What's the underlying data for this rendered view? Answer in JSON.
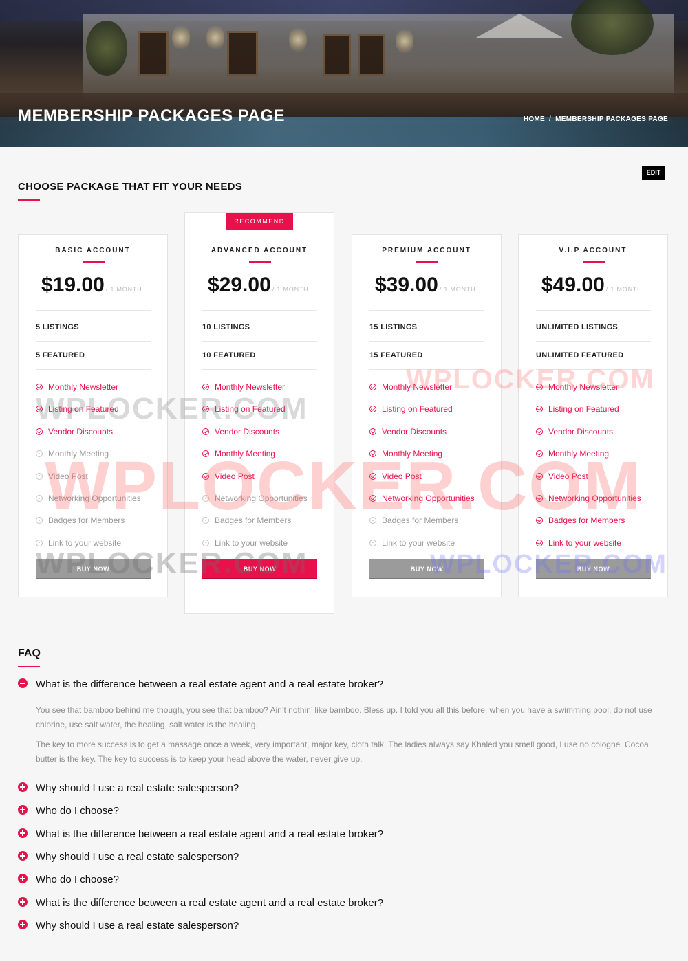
{
  "hero": {
    "title": "MEMBERSHIP PACKAGES PAGE",
    "breadcrumb": [
      "HOME",
      "MEMBERSHIP PACKAGES PAGE"
    ],
    "breadcrumb_sep": "/"
  },
  "edit_label": "EDIT",
  "section_title": "CHOOSE PACKAGE THAT FIT YOUR NEEDS",
  "accent_color": "#e8114b",
  "packages": [
    {
      "name": "BASIC ACCOUNT",
      "price": "$19.00",
      "period": "/ 1 MONTH",
      "listings": "5 LISTINGS",
      "featured": "5 FEATURED",
      "features": [
        {
          "label": "Monthly Newsletter",
          "included": true
        },
        {
          "label": "Listing on Featured",
          "included": true
        },
        {
          "label": "Vendor Discounts",
          "included": true
        },
        {
          "label": "Monthly Meeting",
          "included": false
        },
        {
          "label": "Video Post",
          "included": false
        },
        {
          "label": "Networking Opportunities",
          "included": false
        },
        {
          "label": "Badges for Members",
          "included": false
        },
        {
          "label": "Link to your website",
          "included": false
        }
      ],
      "buy_label": "BUY NOW",
      "recommended": false
    },
    {
      "name": "ADVANCED ACCOUNT",
      "price": "$29.00",
      "period": "/ 1 MONTH",
      "listings": "10 LISTINGS",
      "featured": "10 FEATURED",
      "badge": "RECOMMEND",
      "features": [
        {
          "label": "Monthly Newsletter",
          "included": true
        },
        {
          "label": "Listing on Featured",
          "included": true
        },
        {
          "label": "Vendor Discounts",
          "included": true
        },
        {
          "label": "Monthly Meeting",
          "included": true
        },
        {
          "label": "Video Post",
          "included": true
        },
        {
          "label": "Networking Opportunities",
          "included": false
        },
        {
          "label": "Badges for Members",
          "included": false
        },
        {
          "label": "Link to your website",
          "included": false
        }
      ],
      "buy_label": "BUY NOW",
      "recommended": true
    },
    {
      "name": "PREMIUM ACCOUNT",
      "price": "$39.00",
      "period": "/ 1 MONTH",
      "listings": "15 LISTINGS",
      "featured": "15 FEATURED",
      "features": [
        {
          "label": "Monthly Newsletter",
          "included": true
        },
        {
          "label": "Listing on Featured",
          "included": true
        },
        {
          "label": "Vendor Discounts",
          "included": true
        },
        {
          "label": "Monthly Meeting",
          "included": true
        },
        {
          "label": "Video Post",
          "included": true
        },
        {
          "label": "Networking Opportunities",
          "included": true
        },
        {
          "label": "Badges for Members",
          "included": false
        },
        {
          "label": "Link to your website",
          "included": false
        }
      ],
      "buy_label": "BUY NOW",
      "recommended": false
    },
    {
      "name": "V.I.P ACCOUNT",
      "price": "$49.00",
      "period": "/ 1 MONTH",
      "listings": "UNLIMITED LISTINGS",
      "featured": "UNLIMITED FEATURED",
      "features": [
        {
          "label": "Monthly Newsletter",
          "included": true
        },
        {
          "label": "Listing on Featured",
          "included": true
        },
        {
          "label": "Vendor Discounts",
          "included": true
        },
        {
          "label": "Monthly Meeting",
          "included": true
        },
        {
          "label": "Video Post",
          "included": true
        },
        {
          "label": "Networking Opportunities",
          "included": true
        },
        {
          "label": "Badges for Members",
          "included": true
        },
        {
          "label": "Link to your website",
          "included": true
        }
      ],
      "buy_label": "BUY NOW",
      "recommended": false
    }
  ],
  "faq": {
    "title": "FAQ",
    "items": [
      {
        "question": "What is the difference between a real estate agent and a real estate broker?",
        "expanded": true,
        "answer": [
          "You see that bamboo behind me though, you see that bamboo? Ain’t nothin’ like bamboo. Bless up. I told you all this before, when you have a swimming pool, do not use chlorine, use salt water, the healing, salt water is the healing.",
          "The key to more success is to get a massage once a week, very important, major key, cloth talk. The ladies always say Khaled you smell good, I use no cologne. Cocoa butter is the key. The key to success is to keep your head above the water, never give up."
        ]
      },
      {
        "question": "Why should I use a real estate salesperson?",
        "expanded": false
      },
      {
        "question": "Who do I choose?",
        "expanded": false
      },
      {
        "question": "What is the difference between a real estate agent and a real estate broker?",
        "expanded": false
      },
      {
        "question": "Why should I use a real estate salesperson?",
        "expanded": false
      },
      {
        "question": "Who do I choose?",
        "expanded": false
      },
      {
        "question": "What is the difference between a real estate agent and a real estate broker?",
        "expanded": false
      },
      {
        "question": "Why should I use a real estate salesperson?",
        "expanded": false
      }
    ]
  },
  "watermark": "WPLOCKER.COM"
}
